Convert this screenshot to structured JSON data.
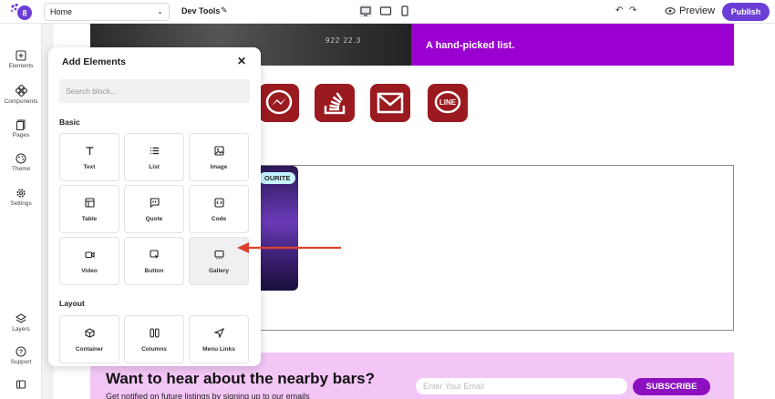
{
  "topbar": {
    "page_select": "Home",
    "site_name": "Dev Tools",
    "preview_label": "Preview",
    "publish_label": "Publish"
  },
  "rail": {
    "items": [
      {
        "label": "Elements",
        "icon": "plus-square-icon"
      },
      {
        "label": "Components",
        "icon": "components-icon"
      },
      {
        "label": "Pages",
        "icon": "pages-icon"
      },
      {
        "label": "Theme",
        "icon": "palette-icon"
      },
      {
        "label": "Settings",
        "icon": "gear-icon"
      },
      {
        "label": "Layers",
        "icon": "layers-icon"
      },
      {
        "label": "Support",
        "icon": "help-icon"
      }
    ]
  },
  "canvas": {
    "hero_caption": "A hand-picked list.",
    "plate_text": "922 22.3",
    "badge": "OURITE",
    "cta_title": "Want to hear about the nearby bars?",
    "cta_sub": "Get notified on future listings by signing up to our emails",
    "email_placeholder": "Enter Your Email",
    "subscribe_label": "SUBSCRIBE",
    "social_icons": [
      "messenger-icon",
      "stackoverflow-icon",
      "mail-icon",
      "line-icon"
    ],
    "line_label": "LINE"
  },
  "panel": {
    "title": "Add Elements",
    "search_placeholder": "Search block...",
    "basic_label": "Basic",
    "layout_label": "Layout",
    "basic": [
      {
        "label": "Text",
        "icon": "text-icon"
      },
      {
        "label": "List",
        "icon": "list-icon"
      },
      {
        "label": "Image",
        "icon": "image-icon"
      },
      {
        "label": "Table",
        "icon": "table-icon"
      },
      {
        "label": "Quote",
        "icon": "quote-icon"
      },
      {
        "label": "Code",
        "icon": "code-icon"
      },
      {
        "label": "Video",
        "icon": "video-icon"
      },
      {
        "label": "Button",
        "icon": "button-icon"
      },
      {
        "label": "Gallery",
        "icon": "gallery-icon"
      }
    ],
    "layout": [
      {
        "label": "Container",
        "icon": "box-icon"
      },
      {
        "label": "Columns",
        "icon": "columns-icon"
      },
      {
        "label": "Menu Links",
        "icon": "send-icon"
      }
    ]
  },
  "colors": {
    "accent": "#6b3fd6",
    "hero_purple": "#9a00cf",
    "social_red": "#9b1a1f",
    "cta_bg": "#f3c6f6",
    "arrow_red": "#e0402b"
  }
}
